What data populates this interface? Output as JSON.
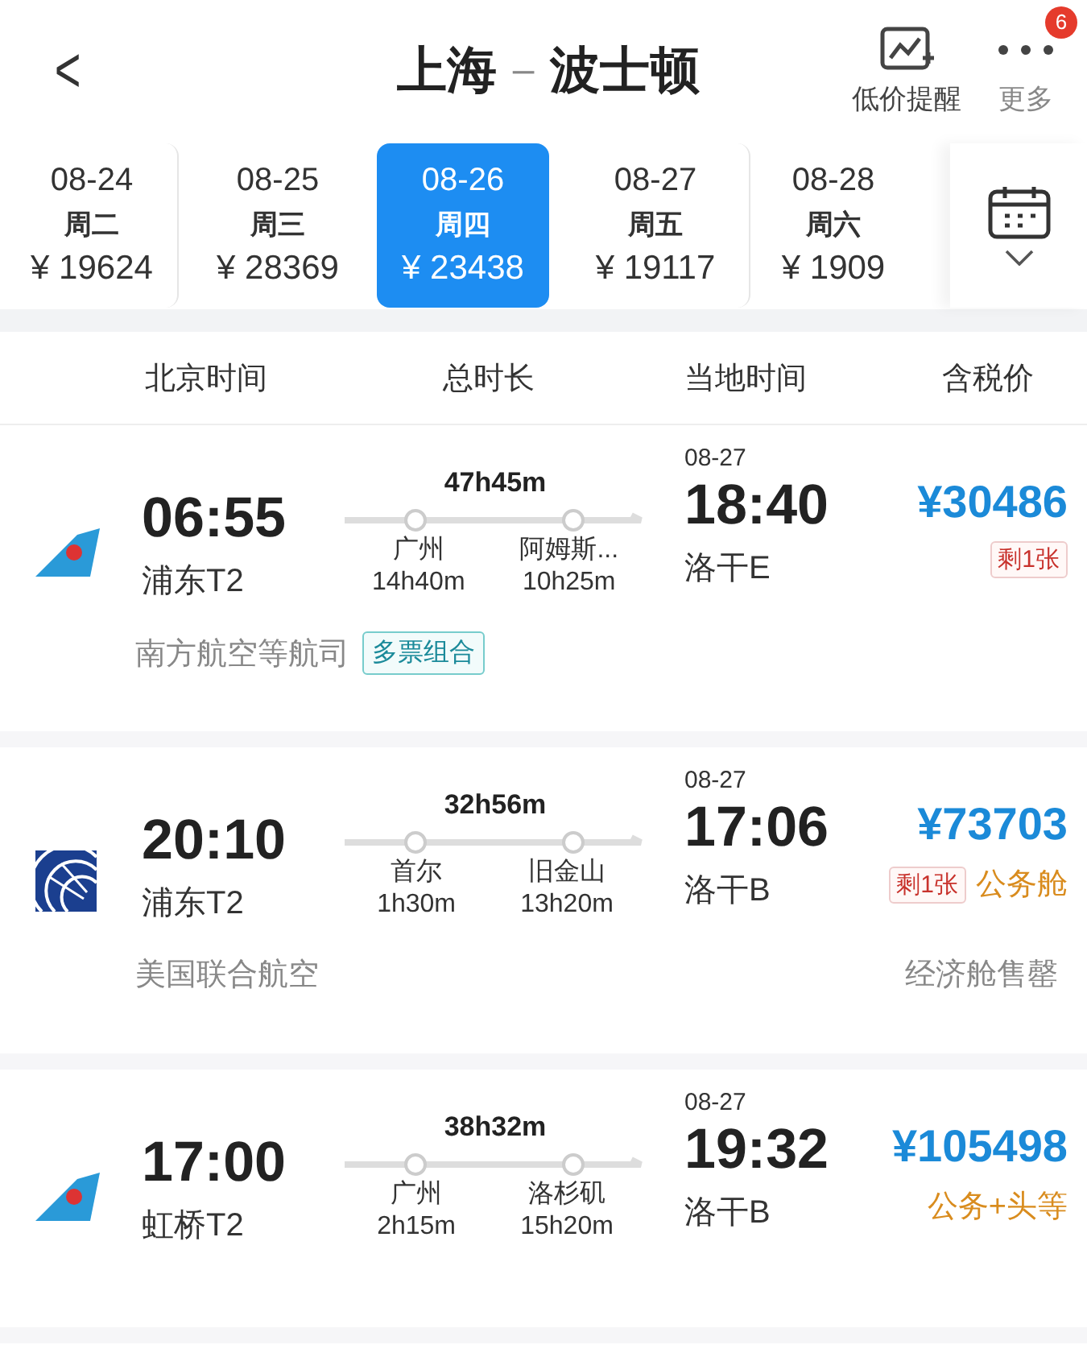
{
  "header": {
    "back": "<",
    "origin": "上海",
    "separator": "–",
    "destination": "波士顿",
    "actions": [
      {
        "kind": "alert",
        "label": "低价提醒"
      },
      {
        "kind": "more",
        "label": "更多",
        "badge": "6"
      }
    ]
  },
  "dates": [
    {
      "date": "08-24",
      "weekday": "周二",
      "price": "¥ 19624",
      "selected": false
    },
    {
      "date": "08-25",
      "weekday": "周三",
      "price": "¥ 28369",
      "selected": false
    },
    {
      "date": "08-26",
      "weekday": "周四",
      "price": "¥ 23438",
      "selected": true
    },
    {
      "date": "08-27",
      "weekday": "周五",
      "price": "¥ 19117",
      "selected": false
    },
    {
      "date": "08-28",
      "weekday": "周六",
      "price": "¥ 1909",
      "selected": false
    }
  ],
  "columns": [
    "北京时间",
    "总时长",
    "当地时间",
    "含税价"
  ],
  "flights": [
    {
      "kind": "tail",
      "depart_time": "06:55",
      "depart_airport": "浦东T2",
      "duration": "47h45m",
      "stops": [
        {
          "city": "广州",
          "wait": "14h40m"
        },
        {
          "city": "阿姆斯...",
          "wait": "10h25m"
        }
      ],
      "arrive_date": "08-27",
      "arrive_time": "18:40",
      "arrive_airport": "洛干E",
      "price": "¥30486",
      "seats_left": "剩1张",
      "airline": "南方航空等航司",
      "combo_tag": "多票组合"
    },
    {
      "kind": "globe",
      "depart_time": "20:10",
      "depart_airport": "浦东T2",
      "duration": "32h56m",
      "stops": [
        {
          "city": "首尔",
          "wait": "1h30m"
        },
        {
          "city": "旧金山",
          "wait": "13h20m"
        }
      ],
      "arrive_date": "08-27",
      "arrive_time": "17:06",
      "arrive_airport": "洛干B",
      "price": "¥73703",
      "seats_left": "剩1张",
      "cabin": "公务舱",
      "airline": "美国联合航空",
      "note": "经济舱售罄"
    },
    {
      "kind": "tail",
      "depart_time": "17:00",
      "depart_airport": "虹桥T2",
      "duration": "38h32m",
      "stops": [
        {
          "city": "广州",
          "wait": "2h15m"
        },
        {
          "city": "洛杉矶",
          "wait": "15h20m"
        }
      ],
      "arrive_date": "08-27",
      "arrive_time": "19:32",
      "arrive_airport": "洛干B",
      "price": "¥105498",
      "cabin": "公务+头等"
    }
  ]
}
